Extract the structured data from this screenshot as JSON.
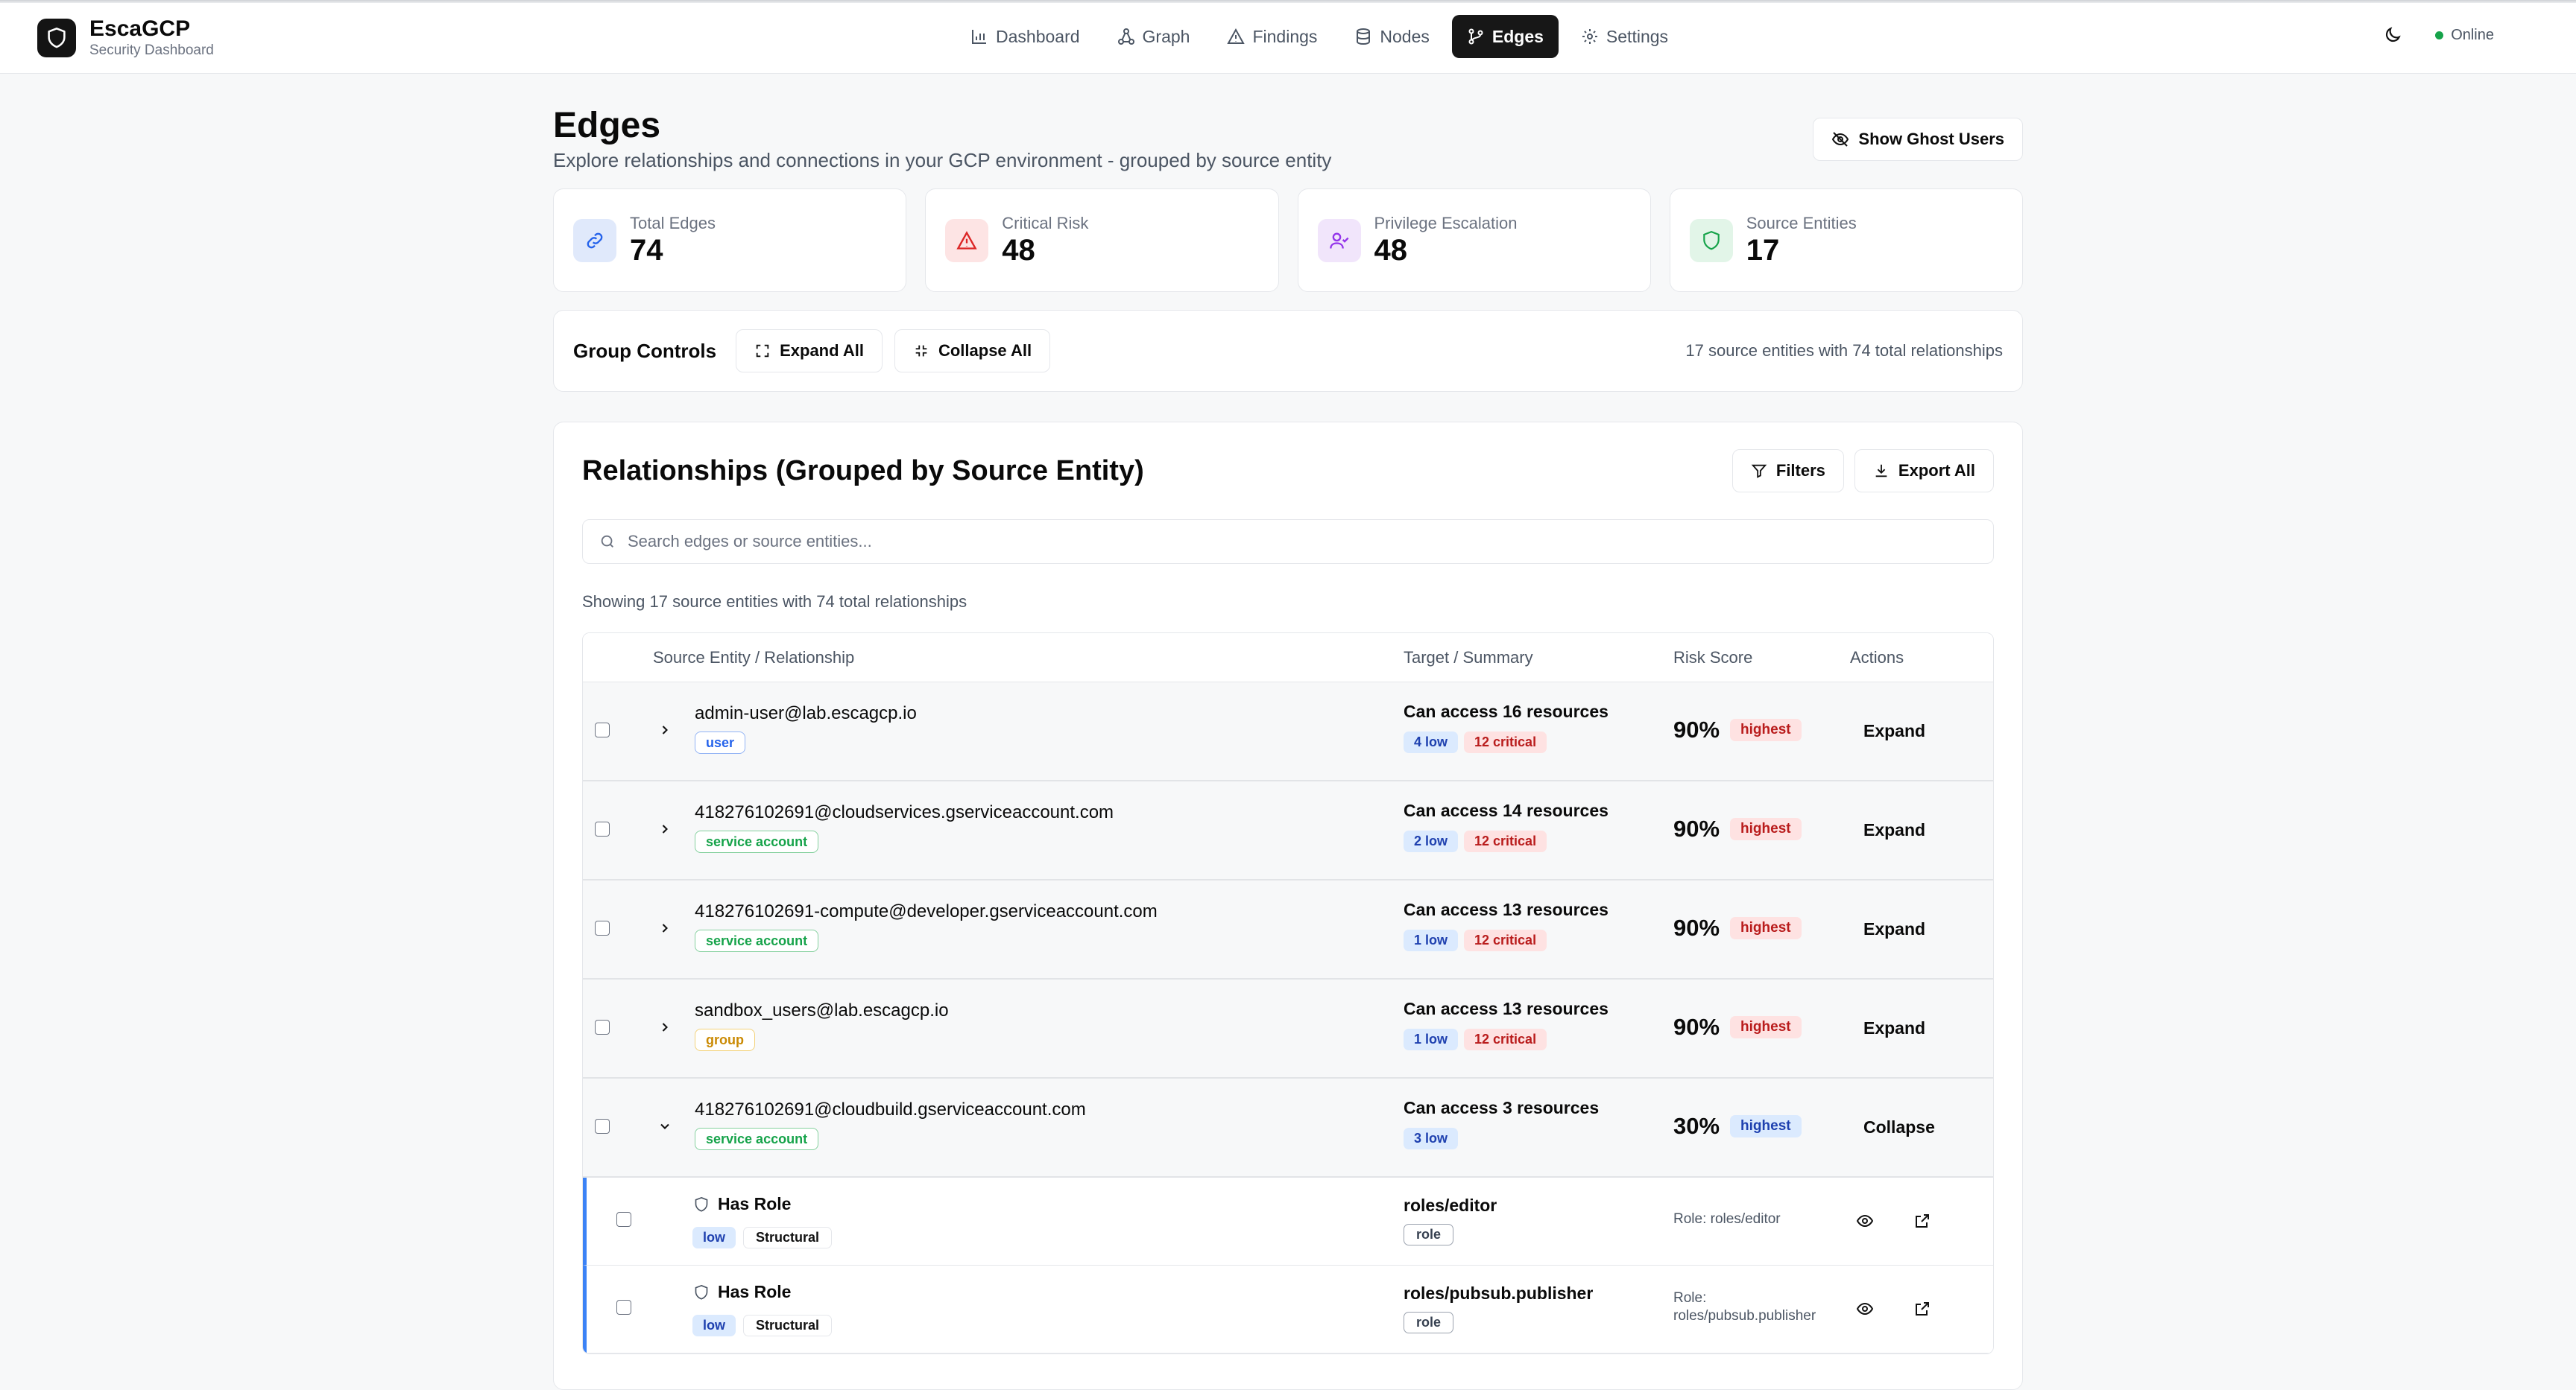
{
  "app": {
    "name": "EscaGCP",
    "subtitle": "Security Dashboard",
    "status": "Online"
  },
  "nav": [
    {
      "label": "Dashboard",
      "icon": "bar-chart-icon"
    },
    {
      "label": "Graph",
      "icon": "graph-icon"
    },
    {
      "label": "Findings",
      "icon": "warning-icon"
    },
    {
      "label": "Nodes",
      "icon": "database-icon"
    },
    {
      "label": "Edges",
      "icon": "git-branch-icon",
      "active": true
    },
    {
      "label": "Settings",
      "icon": "gear-icon"
    }
  ],
  "page": {
    "title": "Edges",
    "subtitle": "Explore relationships and connections in your GCP environment - grouped by source entity",
    "ghost_button": "Show Ghost Users"
  },
  "stats": [
    {
      "label": "Total Edges",
      "value": "74",
      "icon": "link-icon",
      "color": "#2563eb",
      "bg": "#e0e9fb"
    },
    {
      "label": "Critical Risk",
      "value": "48",
      "icon": "alert-triangle-icon",
      "color": "#dc2626",
      "bg": "#fde4e4"
    },
    {
      "label": "Privilege Escalation",
      "value": "48",
      "icon": "user-check-icon",
      "color": "#9333ea",
      "bg": "#f1e5fb"
    },
    {
      "label": "Source Entities",
      "value": "17",
      "icon": "shield-icon",
      "color": "#16a34a",
      "bg": "#e2f5e8"
    }
  ],
  "group_controls": {
    "title": "Group Controls",
    "expand_all": "Expand All",
    "collapse_all": "Collapse All",
    "summary": "17 source entities with 74 total relationships"
  },
  "relationships": {
    "title": "Relationships (Grouped by Source Entity)",
    "filters_label": "Filters",
    "export_label": "Export All",
    "search_placeholder": "Search edges or source entities...",
    "showing": "Showing 17 source entities with 74 total relationships",
    "columns": {
      "source": "Source Entity / Relationship",
      "target": "Target / Summary",
      "risk": "Risk Score",
      "actions": "Actions"
    },
    "rows": [
      {
        "name": "admin-user@lab.escagcp.io",
        "type": "user",
        "type_class": "tag-user",
        "summary": "Can access 16 resources",
        "low": "4 low",
        "critical": "12 critical",
        "score": "90%",
        "badge": "highest",
        "badge_class": "badge-high-red",
        "action": "Expand",
        "expanded": false
      },
      {
        "name": "418276102691@cloudservices.gserviceaccount.com",
        "type": "service account",
        "type_class": "tag-sa",
        "summary": "Can access 14 resources",
        "low": "2 low",
        "critical": "12 critical",
        "score": "90%",
        "badge": "highest",
        "badge_class": "badge-high-red",
        "action": "Expand",
        "expanded": false
      },
      {
        "name": "418276102691-compute@developer.gserviceaccount.com",
        "type": "service account",
        "type_class": "tag-sa",
        "summary": "Can access 13 resources",
        "low": "1 low",
        "critical": "12 critical",
        "score": "90%",
        "badge": "highest",
        "badge_class": "badge-high-red",
        "action": "Expand",
        "expanded": false
      },
      {
        "name": "sandbox_users@lab.escagcp.io",
        "type": "group",
        "type_class": "tag-group",
        "summary": "Can access 13 resources",
        "low": "1 low",
        "critical": "12 critical",
        "score": "90%",
        "badge": "highest",
        "badge_class": "badge-high-red",
        "action": "Expand",
        "expanded": false
      },
      {
        "name": "418276102691@cloudbuild.gserviceaccount.com",
        "type": "service account",
        "type_class": "tag-sa",
        "summary": "Can access 3 resources",
        "low": "3 low",
        "critical": "",
        "score": "30%",
        "badge": "highest",
        "badge_class": "badge-high-blue",
        "action": "Collapse",
        "expanded": true
      }
    ],
    "children": [
      {
        "title": "Has Role",
        "severity": "low",
        "category": "Structural",
        "target": "roles/editor",
        "target_type": "role",
        "note": "Role: roles/editor"
      },
      {
        "title": "Has Role",
        "severity": "low",
        "category": "Structural",
        "target": "roles/pubsub.publisher",
        "target_type": "role",
        "note": "Role:\nroles/pubsub.publisher"
      }
    ]
  }
}
